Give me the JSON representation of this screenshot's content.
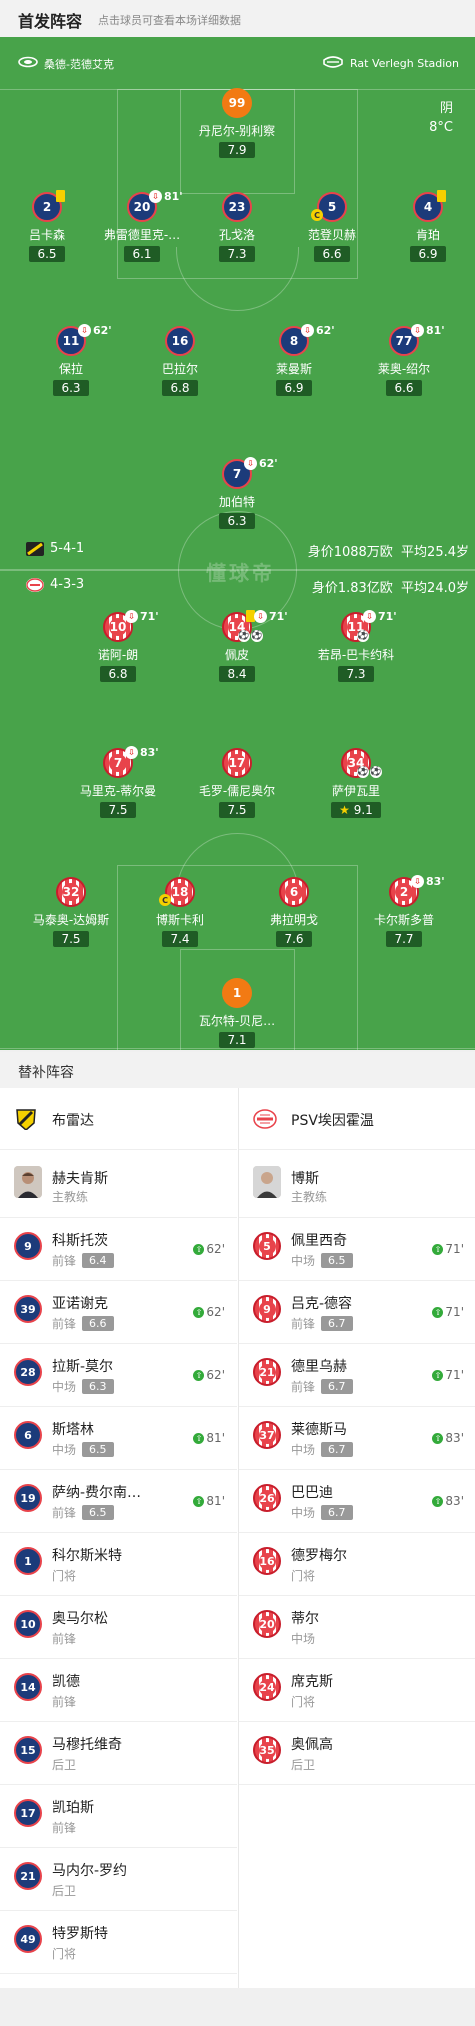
{
  "header": {
    "title": "首发阵容",
    "subtitle": "点击球员可查看本场详细数据"
  },
  "pitch": {
    "venue_left": "桑德-范德艾克",
    "venue_right": "Rat Verlegh Stadion",
    "weather": "阴",
    "temp": "8°C",
    "watermark": "懂球帝"
  },
  "home": {
    "formation": "5-4-1",
    "value": "身价1088万欧",
    "age": "平均25.4岁",
    "color": "#1c3b7a"
  },
  "away": {
    "formation": "4-3-3",
    "value": "身价1.83亿欧",
    "age": "平均24.0岁",
    "color": "#e8434b"
  },
  "players": [
    {
      "num": "99",
      "name": "丹尼尔-别利察",
      "rating": "7.9",
      "team": "home",
      "gk": true
    },
    {
      "num": "2",
      "name": "吕卡森",
      "rating": "6.5",
      "team": "home",
      "yellow": true
    },
    {
      "num": "20",
      "name": "弗雷德里克-…",
      "rating": "6.1",
      "team": "home",
      "sub": "81'"
    },
    {
      "num": "23",
      "name": "孔戈洛",
      "rating": "7.3",
      "team": "home"
    },
    {
      "num": "5",
      "name": "范登贝赫",
      "rating": "6.6",
      "team": "home",
      "captain": true
    },
    {
      "num": "4",
      "name": "肯珀",
      "rating": "6.9",
      "team": "home",
      "yellow": true
    },
    {
      "num": "11",
      "name": "保拉",
      "rating": "6.3",
      "team": "home",
      "sub": "62'"
    },
    {
      "num": "16",
      "name": "巴拉尔",
      "rating": "6.8",
      "team": "home"
    },
    {
      "num": "8",
      "name": "莱曼斯",
      "rating": "6.9",
      "team": "home",
      "sub": "62'"
    },
    {
      "num": "77",
      "name": "莱奥-绍尔",
      "rating": "6.6",
      "team": "home",
      "sub": "81'"
    },
    {
      "num": "7",
      "name": "加伯特",
      "rating": "6.3",
      "team": "home",
      "sub": "62'"
    },
    {
      "num": "10",
      "name": "诺阿-朗",
      "rating": "6.8",
      "team": "away",
      "sub": "71'"
    },
    {
      "num": "14",
      "name": "佩皮",
      "rating": "8.4",
      "team": "away",
      "sub": "71'",
      "yellow": true,
      "balls": 2
    },
    {
      "num": "11",
      "name": "若昂-巴卡约科",
      "rating": "7.3",
      "team": "away",
      "sub": "71'",
      "balls": 1
    },
    {
      "num": "7",
      "name": "马里克-蒂尔曼",
      "rating": "7.5",
      "team": "away",
      "sub": "83'"
    },
    {
      "num": "17",
      "name": "毛罗-儒尼奥尔",
      "rating": "7.5",
      "team": "away"
    },
    {
      "num": "34",
      "name": "萨伊瓦里",
      "rating": "9.1",
      "team": "away",
      "star": true,
      "balls": 2
    },
    {
      "num": "32",
      "name": "马泰奥-达姆斯",
      "rating": "7.5",
      "team": "away"
    },
    {
      "num": "18",
      "name": "博斯卡利",
      "rating": "7.4",
      "team": "away",
      "captain": true
    },
    {
      "num": "6",
      "name": "弗拉明戈",
      "rating": "7.6",
      "team": "away"
    },
    {
      "num": "2",
      "name": "卡尔斯多普",
      "rating": "7.7",
      "team": "away",
      "sub": "83'"
    },
    {
      "num": "1",
      "name": "瓦尔特-贝尼…",
      "rating": "7.1",
      "team": "away",
      "gk": true
    }
  ],
  "bench_header": "替补阵容",
  "bench_home": {
    "team": "布雷达",
    "coach": {
      "name": "赫夫肯斯",
      "role": "主教练"
    },
    "subs": [
      {
        "num": "9",
        "name": "科斯托茨",
        "pos": "前锋",
        "rating": "6.4",
        "in": "62'"
      },
      {
        "num": "39",
        "name": "亚诺谢克",
        "pos": "前锋",
        "rating": "6.6",
        "in": "62'"
      },
      {
        "num": "28",
        "name": "拉斯-莫尔",
        "pos": "中场",
        "rating": "6.3",
        "in": "62'"
      },
      {
        "num": "6",
        "name": "斯塔林",
        "pos": "中场",
        "rating": "6.5",
        "in": "81'"
      },
      {
        "num": "19",
        "name": "萨纳-费尔南…",
        "pos": "前锋",
        "rating": "6.5",
        "in": "81'"
      },
      {
        "num": "1",
        "name": "科尔斯米特",
        "pos": "门将"
      },
      {
        "num": "10",
        "name": "奥马尔松",
        "pos": "前锋"
      },
      {
        "num": "14",
        "name": "凯德",
        "pos": "前锋"
      },
      {
        "num": "15",
        "name": "马穆托维奇",
        "pos": "后卫"
      },
      {
        "num": "17",
        "name": "凯珀斯",
        "pos": "前锋"
      },
      {
        "num": "21",
        "name": "马内尔-罗约",
        "pos": "后卫"
      },
      {
        "num": "49",
        "name": "特罗斯特",
        "pos": "门将"
      }
    ]
  },
  "bench_away": {
    "team": "PSV埃因霍温",
    "coach": {
      "name": "博斯",
      "role": "主教练"
    },
    "subs": [
      {
        "num": "5",
        "name": "佩里西奇",
        "pos": "中场",
        "rating": "6.5",
        "in": "71'"
      },
      {
        "num": "9",
        "name": "吕克-德容",
        "pos": "前锋",
        "rating": "6.7",
        "in": "71'"
      },
      {
        "num": "21",
        "name": "德里乌赫",
        "pos": "前锋",
        "rating": "6.7",
        "in": "71'"
      },
      {
        "num": "37",
        "name": "莱德斯马",
        "pos": "中场",
        "rating": "6.7",
        "in": "83'"
      },
      {
        "num": "26",
        "name": "巴巴迪",
        "pos": "中场",
        "rating": "6.7",
        "in": "83'"
      },
      {
        "num": "16",
        "name": "德罗梅尔",
        "pos": "门将"
      },
      {
        "num": "20",
        "name": "蒂尔",
        "pos": "中场"
      },
      {
        "num": "24",
        "name": "席克斯",
        "pos": "门将"
      },
      {
        "num": "35",
        "name": "奥佩高",
        "pos": "后卫"
      }
    ]
  }
}
